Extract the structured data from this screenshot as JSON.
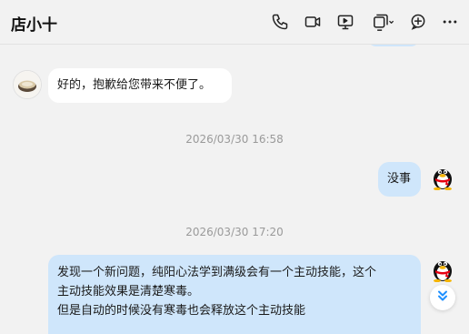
{
  "header": {
    "title": "店小十",
    "icons": [
      "phone-icon",
      "video-call-icon",
      "screen-share-icon",
      "multi-window-icon",
      "add-icon",
      "more-icon"
    ]
  },
  "messages": [
    {
      "side": "left",
      "text": "好的，抱歉给您带来不便了。"
    },
    {
      "timestamp": "2026/03/30 16:58"
    },
    {
      "side": "right",
      "text": "没事"
    },
    {
      "timestamp": "2026/03/30 17:20"
    },
    {
      "side": "right",
      "lines": [
        "发现一个新问题，纯阳心法学到满级会有一个主动技能，这个",
        "主动技能效果是清楚寒毒。",
        "但是自动的时候没有寒毒也会释放这个主动技能"
      ]
    }
  ],
  "colors": {
    "background": "#f2f2f2",
    "my_bubble": "#cfe6fb",
    "their_bubble": "#ffffff",
    "accent": "#1e90ff"
  }
}
